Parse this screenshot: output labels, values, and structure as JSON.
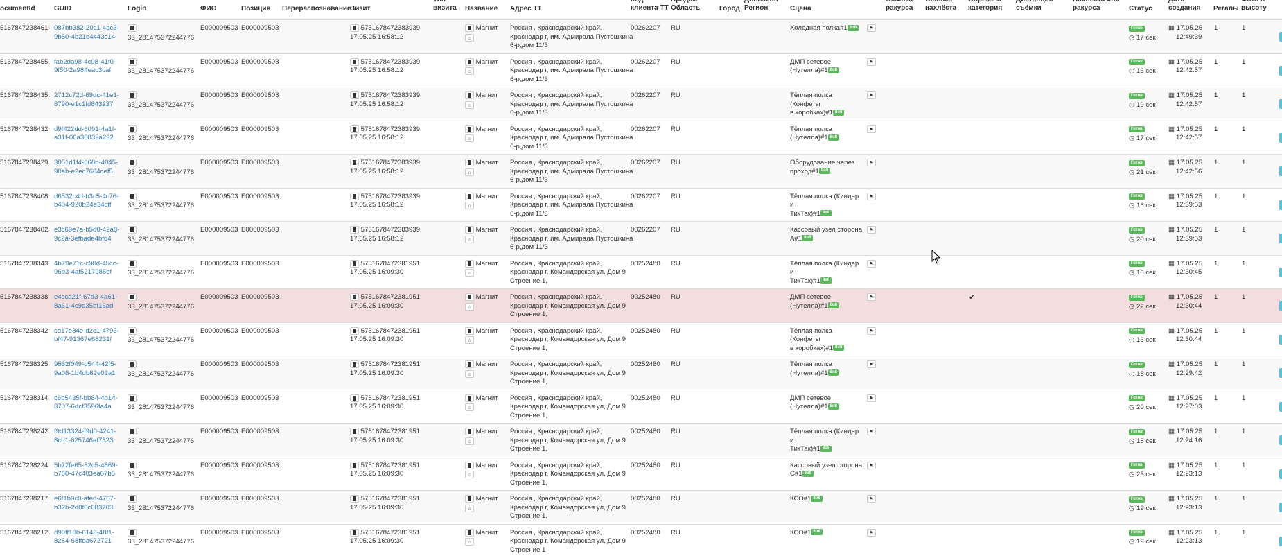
{
  "headers": [
    {
      "id": "documentid",
      "label": "ocumentId"
    },
    {
      "id": "guid",
      "label": "GUID"
    },
    {
      "id": "login",
      "label": "Login"
    },
    {
      "id": "fio",
      "label": "ФИО"
    },
    {
      "id": "position",
      "label": "Позиция"
    },
    {
      "id": "redistribution",
      "label": "Перераспознавание"
    },
    {
      "id": "visit",
      "label": "Визит"
    },
    {
      "id": "visit-type",
      "label": "Тип визита"
    },
    {
      "id": "name",
      "label": "Название"
    },
    {
      "id": "tt-address",
      "label": "Адрес ТТ"
    },
    {
      "id": "tt-client-code",
      "label": "Код клиента ТТ"
    },
    {
      "id": "sales-region",
      "label": "Продаж Область"
    },
    {
      "id": "city",
      "label": "Город"
    },
    {
      "id": "division-region",
      "label": "Дивизион Регион"
    },
    {
      "id": "scene",
      "label": "Сцена"
    },
    {
      "id": "angle-error",
      "label": "Ошибка ракурса"
    },
    {
      "id": "overlap-error",
      "label": "Ошибка нахлёста"
    },
    {
      "id": "cut-category",
      "label": "Обрезана категория"
    },
    {
      "id": "shot-distance",
      "label": "Дистанция съёмки"
    },
    {
      "id": "overlap-or-angle",
      "label": "Нахлёста или ракурса"
    },
    {
      "id": "status",
      "label": "Статус"
    },
    {
      "id": "created-date",
      "label": "Дата создания"
    },
    {
      "id": "shelves",
      "label": "Регалы"
    },
    {
      "id": "photo-height",
      "label": "Фото в высоту"
    }
  ],
  "rows": [
    {
      "doc_id": "5167847238461",
      "guid_1": "087bb382-20c1-4ac3-",
      "guid_2": "9b50-4b21e4443c14",
      "login": "33_281475372244776",
      "fio": "E000009503",
      "position": "E000009503",
      "visit_id": "5751678472383939",
      "visit_dt": "17.05.25 16:58:12",
      "store": "Магнит",
      "addr": [
        "Россия , Краснодарский край,",
        "Краснодар г, им. Адмирала Пустошкина",
        "6-р,дом 11/3"
      ],
      "client_code": "00262207",
      "region": "RU",
      "scene": [
        "Холодная полка#1"
      ],
      "scene_badge": "8o8",
      "status": "Готов",
      "duration": "17 сек",
      "created_date": "17.05.25",
      "created_time": "12:49:39",
      "shelves": "1",
      "photo_h": "1"
    },
    {
      "doc_id": "5167847238455",
      "guid_1": "fab2da98-4c08-41f0-",
      "guid_2": "9f50-2a984eac3caf",
      "login": "33_281475372244776",
      "fio": "E000009503",
      "position": "E000009503",
      "visit_id": "5751678472383939",
      "visit_dt": "17.05.25 16:58:12",
      "store": "Магнит",
      "addr": [
        "Россия , Краснодарский край,",
        "Краснодар г, им. Адмирала Пустошкина",
        "6-р,дом 11/3"
      ],
      "client_code": "00262207",
      "region": "RU",
      "scene": [
        "ДМП сетевое",
        "(Нутелла)#1"
      ],
      "scene_badge": "8o8",
      "status": "Готов",
      "duration": "16 сек",
      "created_date": "17.05.25",
      "created_time": "12:42:57",
      "shelves": "1",
      "photo_h": "1"
    },
    {
      "doc_id": "5167847238435",
      "guid_1": "2712c72d-69dc-41e1-",
      "guid_2": "8790-e1c1fd843237",
      "login": "33_281475372244776",
      "fio": "E000009503",
      "position": "E000009503",
      "visit_id": "5751678472383939",
      "visit_dt": "17.05.25 16:58:12",
      "store": "Магнит",
      "addr": [
        "Россия , Краснодарский край,",
        "Краснодар г, им. Адмирала Пустошкина",
        "6-р,дом 11/3"
      ],
      "client_code": "00262207",
      "region": "RU",
      "scene": [
        "Тёплая полка (Конфеты",
        "в коробках)#1"
      ],
      "scene_badge": "8o8",
      "status": "Готов",
      "duration": "19 сек",
      "created_date": "17.05.25",
      "created_time": "12:42:57",
      "shelves": "1",
      "photo_h": "1"
    },
    {
      "doc_id": "5167847238432",
      "guid_1": "d9f422dd-6091-4a1f-",
      "guid_2": "a31f-06a30839a292",
      "login": "33_281475372244776",
      "fio": "E000009503",
      "position": "E000009503",
      "visit_id": "5751678472383939",
      "visit_dt": "17.05.25 16:58:12",
      "store": "Магнит",
      "addr": [
        "Россия , Краснодарский край,",
        "Краснодар г, им. Адмирала Пустошкина",
        "6-р,дом 11/3"
      ],
      "client_code": "00262207",
      "region": "RU",
      "scene": [
        "Тёплая полка",
        "(Нутелла)#1"
      ],
      "scene_badge": "8o8",
      "status": "Готов",
      "duration": "17 сек",
      "created_date": "17.05.25",
      "created_time": "12:42:57",
      "shelves": "1",
      "photo_h": "1"
    },
    {
      "doc_id": "5167847238429",
      "guid_1": "3051d1f4-668b-4045-",
      "guid_2": "90ab-e2ec7604cef5",
      "login": "33_281475372244776",
      "fio": "E000009503",
      "position": "E000009503",
      "visit_id": "5751678472383939",
      "visit_dt": "17.05.25 16:58:12",
      "store": "Магнит",
      "addr": [
        "Россия , Краснодарский край,",
        "Краснодар г, им. Адмирала Пустошкина",
        "6-р,дом 11/3"
      ],
      "client_code": "00262207",
      "region": "RU",
      "scene": [
        "Оборудование через",
        "проход#1"
      ],
      "scene_badge": "8o8",
      "status": "Готов",
      "duration": "21 сек",
      "created_date": "17.05.25",
      "created_time": "12:42:56",
      "shelves": "1",
      "photo_h": "1"
    },
    {
      "doc_id": "5167847238408",
      "guid_1": "d6532c4d-b3c5-4c76-",
      "guid_2": "b404-920b24e34cff",
      "login": "33_281475372244776",
      "fio": "E000009503",
      "position": "E000009503",
      "visit_id": "5751678472383939",
      "visit_dt": "17.05.25 16:58:12",
      "store": "Магнит",
      "addr": [
        "Россия , Краснодарский край,",
        "Краснодар г, им. Адмирала Пустошкина",
        "6-р,дом 11/3"
      ],
      "client_code": "00262207",
      "region": "RU",
      "scene": [
        "Тёплая полка (Киндер и",
        "ТикТак)#1"
      ],
      "scene_badge": "8o8",
      "status": "Готов",
      "duration": "16 сек",
      "created_date": "17.05.25",
      "created_time": "12:39:53",
      "shelves": "1",
      "photo_h": "1"
    },
    {
      "doc_id": "5167847238402",
      "guid_1": "e3c69e7a-b5d0-42a8-",
      "guid_2": "9c2a-3efbade4bfd4",
      "login": "33_281475372244776",
      "fio": "E000009503",
      "position": "E000009503",
      "visit_id": "5751678472383939",
      "visit_dt": "17.05.25 16:58:12",
      "store": "Магнит",
      "addr": [
        "Россия , Краснодарский край,",
        "Краснодар г, им. Адмирала Пустошкина",
        "6-р,дом 11/3"
      ],
      "client_code": "00262207",
      "region": "RU",
      "scene": [
        "Кассовый узел сторона",
        "А#1"
      ],
      "scene_badge": "8o8",
      "status": "Готов",
      "duration": "20 сек",
      "created_date": "17.05.25",
      "created_time": "12:39:53",
      "shelves": "1",
      "photo_h": "1"
    },
    {
      "doc_id": "5167847238343",
      "guid_1": "4b79e71c-c90d-45cc-",
      "guid_2": "96d3-4af5217985ef",
      "login": "33_281475372244776",
      "fio": "E000009503",
      "position": "E000009503",
      "visit_id": "5751678472381951",
      "visit_dt": "17.05.25 16:09:30",
      "store": "Магнит",
      "addr": [
        "Россия , Краснодарский край,",
        "Краснодар г, Командорская ул, Дом 9",
        "Строение 1,"
      ],
      "client_code": "00252480",
      "region": "RU",
      "scene": [
        "Тёплая полка (Киндер и",
        "ТикТак)#1"
      ],
      "scene_badge": "8o8",
      "status": "Готов",
      "duration": "16 сек",
      "created_date": "17.05.25",
      "created_time": "12:30:45",
      "shelves": "1",
      "photo_h": "1"
    },
    {
      "doc_id": "5167847238338",
      "guid_1": "e4cca21f-67d3-4a61-",
      "guid_2": "8a61-4c9d35bf16ad",
      "login": "33_281475372244776",
      "fio": "E000009503",
      "position": "E000009503",
      "visit_id": "5751678472381951",
      "visit_dt": "17.05.25 16:09:30",
      "store": "Магнит",
      "addr": [
        "Россия , Краснодарский край,",
        "Краснодар г, Командорская ул, Дом 9",
        "Строение 1,"
      ],
      "client_code": "00252480",
      "region": "RU",
      "scene": [
        "ДМП сетевое",
        "(Нутелла)#1"
      ],
      "scene_badge": "8o8",
      "status": "Готов",
      "duration": "22 сек",
      "created_date": "17.05.25",
      "created_time": "12:30:44",
      "shelves": "1",
      "photo_h": "1",
      "highlight": true,
      "cut_category": "✔"
    },
    {
      "doc_id": "5167847238342",
      "guid_1": "cd17e84e-d2c1-4793-",
      "guid_2": "bf47-91367e68231f",
      "login": "33_281475372244776",
      "fio": "E000009503",
      "position": "E000009503",
      "visit_id": "5751678472381951",
      "visit_dt": "17.05.25 16:09:30",
      "store": "Магнит",
      "addr": [
        "Россия , Краснодарский край,",
        "Краснодар г, Командорская ул, Дом 9",
        "Строение 1,"
      ],
      "client_code": "00252480",
      "region": "RU",
      "scene": [
        "Тёплая полка (Конфеты",
        "в коробках)#1"
      ],
      "scene_badge": "8o8",
      "status": "Готов",
      "duration": "16 сек",
      "created_date": "17.05.25",
      "created_time": "12:30:44",
      "shelves": "1",
      "photo_h": "1"
    },
    {
      "doc_id": "5167847238325",
      "guid_1": "9562f049-d544-42f5-",
      "guid_2": "9a08-1b4db62e02a1",
      "login": "33_281475372244776",
      "fio": "E000009503",
      "position": "E000009503",
      "visit_id": "5751678472381951",
      "visit_dt": "17.05.25 16:09:30",
      "store": "Магнит",
      "addr": [
        "Россия , Краснодарский край,",
        "Краснодар г, Командорская ул, Дом 9",
        "Строение 1,"
      ],
      "client_code": "00252480",
      "region": "RU",
      "scene": [
        "Тёплая полка",
        "(Нутелла)#1"
      ],
      "scene_badge": "8o8",
      "status": "Готов",
      "duration": "18 сек",
      "created_date": "17.05.25",
      "created_time": "12:29:42",
      "shelves": "1",
      "photo_h": "1"
    },
    {
      "doc_id": "5167847238314",
      "guid_1": "c6b5435f-bb84-4b14-",
      "guid_2": "8707-6dcf3596fa4a",
      "login": "33_281475372244776",
      "fio": "E000009503",
      "position": "E000009503",
      "visit_id": "5751678472381951",
      "visit_dt": "17.05.25 16:09:30",
      "store": "Магнит",
      "addr": [
        "Россия , Краснодарский край,",
        "Краснодар г, Командорская ул, Дом 9",
        "Строение 1,"
      ],
      "client_code": "00252480",
      "region": "RU",
      "scene": [
        "ДМП сетевое",
        "(Нутелла)#1"
      ],
      "scene_badge": "8o8",
      "status": "Готов",
      "duration": "20 сек",
      "created_date": "17.05.25",
      "created_time": "12:27:03",
      "shelves": "1",
      "photo_h": "1"
    },
    {
      "doc_id": "5167847238242",
      "guid_1": "f9d13324-f9d0-4241-",
      "guid_2": "8cb1-625746af7323",
      "login": "33_281475372244776",
      "fio": "E000009503",
      "position": "E000009503",
      "visit_id": "5751678472381951",
      "visit_dt": "17.05.25 16:09:30",
      "store": "Магнит",
      "addr": [
        "Россия , Краснодарский край,",
        "Краснодар г, Командорская ул, Дом 9",
        "Строение 1,"
      ],
      "client_code": "00252480",
      "region": "RU",
      "scene": [
        "Тёплая полка (Киндер и",
        "ТикТак)#1"
      ],
      "scene_badge": "8o8",
      "status": "Готов",
      "duration": "15 сек",
      "created_date": "17.05.25",
      "created_time": "12:24:16",
      "shelves": "1",
      "photo_h": "1"
    },
    {
      "doc_id": "5167847238224",
      "guid_1": "5b72fe65-32c5-4869-",
      "guid_2": "b760-47c403ea67b5",
      "login": "33_281475372244776",
      "fio": "E000009503",
      "position": "E000009503",
      "visit_id": "5751678472381951",
      "visit_dt": "17.05.25 16:09:30",
      "store": "Магнит",
      "addr": [
        "Россия , Краснодарский край,",
        "Краснодар г, Командорская ул, Дом 9",
        "Строение 1,"
      ],
      "client_code": "00252480",
      "region": "RU",
      "scene": [
        "Кассовый узел сторона",
        "С#1"
      ],
      "scene_badge": "8o8",
      "status": "Готов",
      "duration": "23 сек",
      "created_date": "17.05.25",
      "created_time": "12:23:13",
      "shelves": "1",
      "photo_h": "1"
    },
    {
      "doc_id": "5167847238217",
      "guid_1": "e6f1b9c0-afed-4767-",
      "guid_2": "b32b-2d0f0c083703",
      "login": "33_281475372244776",
      "fio": "E000009503",
      "position": "E000009503",
      "visit_id": "5751678472381951",
      "visit_dt": "17.05.25 16:09:30",
      "store": "Магнит",
      "addr": [
        "Россия , Краснодарский край,",
        "Краснодар г, Командорская ул, Дом 9",
        "Строение 1,"
      ],
      "client_code": "00252480",
      "region": "RU",
      "scene": [
        "КСО#1"
      ],
      "scene_badge": "8o8",
      "status": "Готов",
      "duration": "19 сек",
      "created_date": "17.05.25",
      "created_time": "12:23:13",
      "shelves": "1",
      "photo_h": "1"
    },
    {
      "doc_id": "5167847238212",
      "guid_1": "d90ff10b-6143-48f1-",
      "guid_2": "8254-68ffda672721",
      "login": "33_281475372244776",
      "fio": "E000009503",
      "position": "E000009503",
      "visit_id": "5751678472381951",
      "visit_dt": "17.05.25 16:09:30",
      "store": "Магнит",
      "addr": [
        "Россия , Краснодарский край,",
        "Краснодар г, Командорская ул, Дом 9",
        "Строение 1"
      ],
      "client_code": "00252480",
      "region": "RU",
      "scene": [
        "КСО#1"
      ],
      "scene_badge": "8o8",
      "status": "Готов",
      "duration": "19 сек",
      "created_date": "17.05.25",
      "created_time": "12:23:13",
      "shelves": "1",
      "photo_h": "1"
    }
  ]
}
